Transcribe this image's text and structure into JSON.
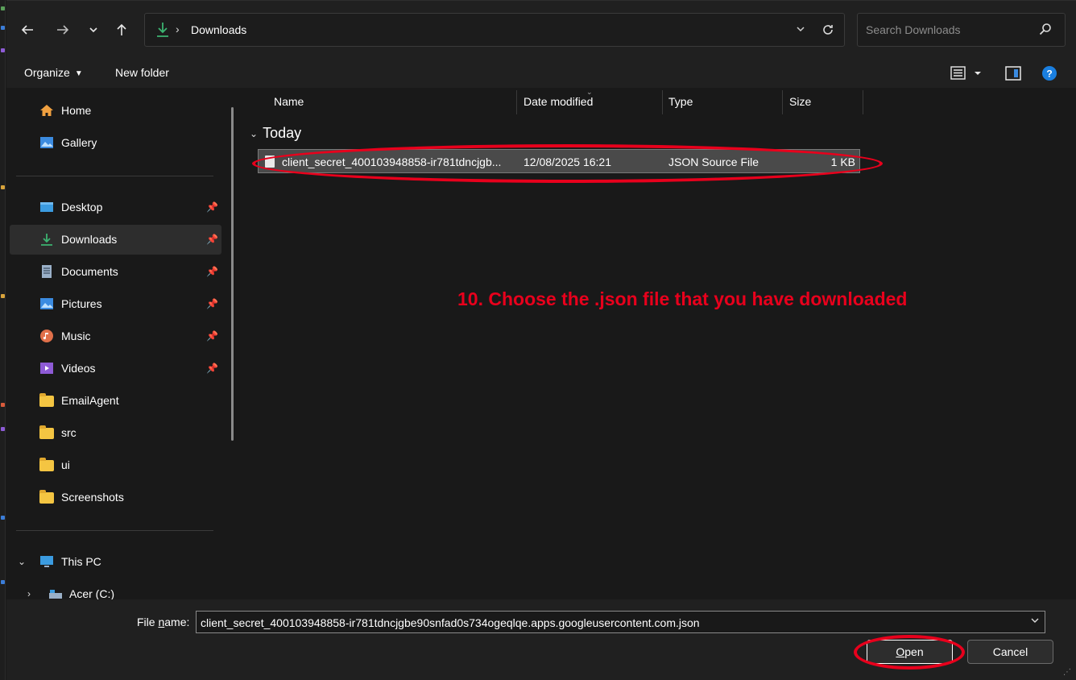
{
  "colors": {
    "accent": "#e8001c",
    "download_green": "#3cb371",
    "help_blue": "#1a7fe0",
    "folder_yellow": "#f4c542"
  },
  "toolbar": {
    "back_icon": "arrow-left-icon",
    "forward_icon": "arrow-right-icon",
    "recent_icon": "chevron-down-icon",
    "up_icon": "arrow-up-icon",
    "path_separator": "›",
    "path": "Downloads",
    "search_placeholder": "Search Downloads"
  },
  "commandbar": {
    "organize": "Organize",
    "new_folder": "New folder"
  },
  "sidebar": {
    "items": [
      {
        "label": "Home",
        "icon": "home-icon"
      },
      {
        "label": "Gallery",
        "icon": "gallery-icon"
      },
      {
        "label": "Desktop",
        "icon": "desktop-icon",
        "pinned": true
      },
      {
        "label": "Downloads",
        "icon": "download-icon",
        "pinned": true,
        "selected": true
      },
      {
        "label": "Documents",
        "icon": "document-icon",
        "pinned": true
      },
      {
        "label": "Pictures",
        "icon": "pictures-icon",
        "pinned": true
      },
      {
        "label": "Music",
        "icon": "music-icon",
        "pinned": true
      },
      {
        "label": "Videos",
        "icon": "videos-icon",
        "pinned": true
      },
      {
        "label": "EmailAgent",
        "icon": "folder-icon"
      },
      {
        "label": "src",
        "icon": "folder-icon"
      },
      {
        "label": "ui",
        "icon": "folder-icon"
      },
      {
        "label": "Screenshots",
        "icon": "folder-icon"
      },
      {
        "label": "This PC",
        "icon": "pc-icon"
      },
      {
        "label": "Acer (C:)",
        "icon": "drive-icon"
      }
    ]
  },
  "main": {
    "columns": {
      "name": "Name",
      "date": "Date modified",
      "type": "Type",
      "size": "Size"
    },
    "group": "Today",
    "files": [
      {
        "name": "client_secret_400103948858-ir781tdncjgb...",
        "date": "12/08/2025 16:21",
        "type": "JSON Source File",
        "size": "1 KB"
      }
    ],
    "annotation": "10. Choose the .json file that you have downloaded"
  },
  "footer": {
    "filename_label_prefix": "File ",
    "filename_label_underlined": "n",
    "filename_label_suffix": "ame:",
    "filename_value": "client_secret_400103948858-ir781tdncjgbe90snfad0s734ogeqlqe.apps.googleusercontent.com.json",
    "open_underlined": "O",
    "open_rest": "pen",
    "cancel": "Cancel"
  }
}
